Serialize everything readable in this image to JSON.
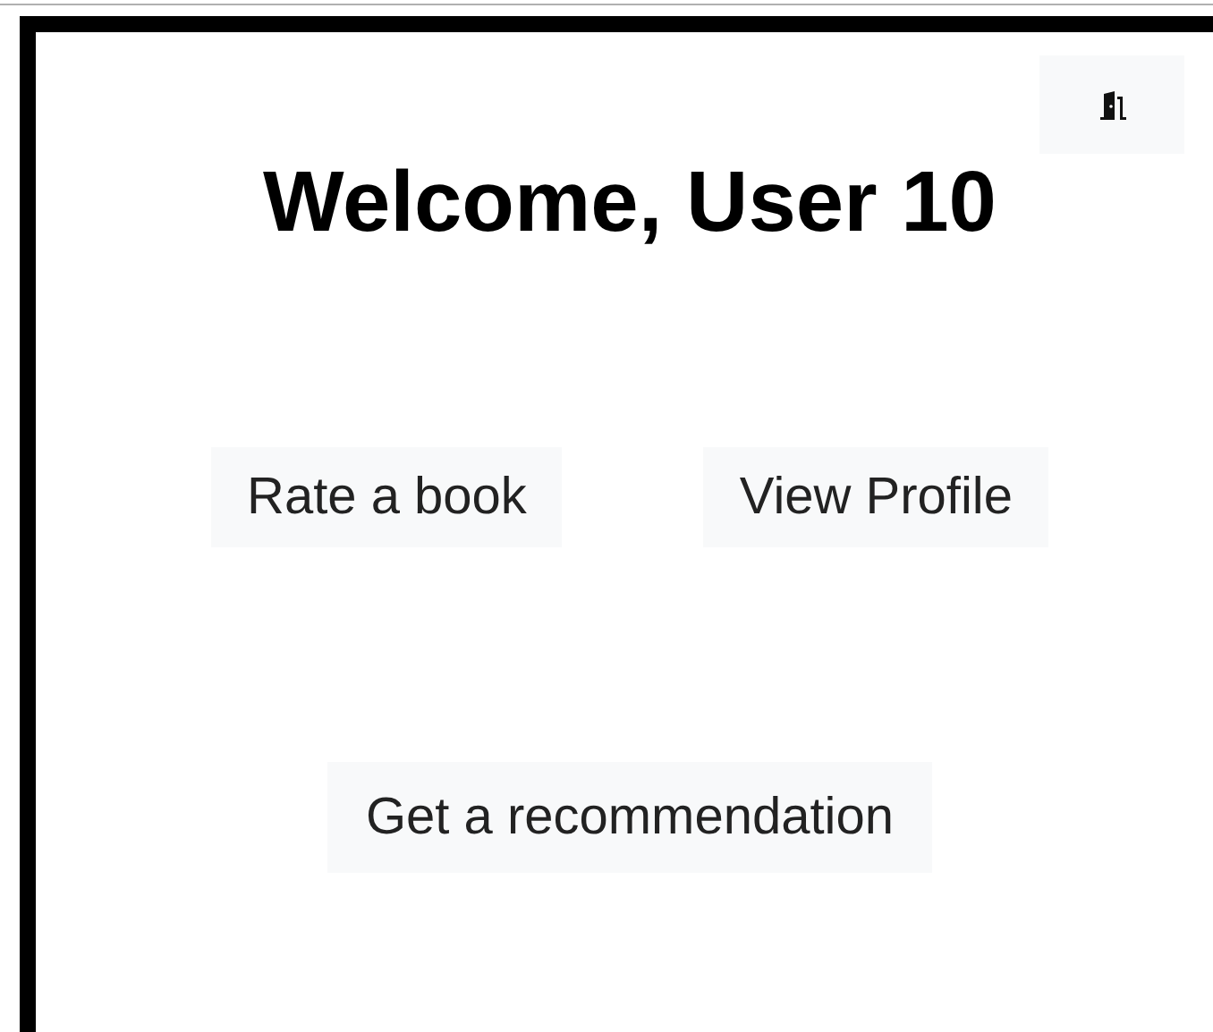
{
  "title": "Welcome, User 10",
  "buttons": [
    "Rate a book",
    "View Profile"
  ],
  "recommend_button": "Get a recommendation"
}
